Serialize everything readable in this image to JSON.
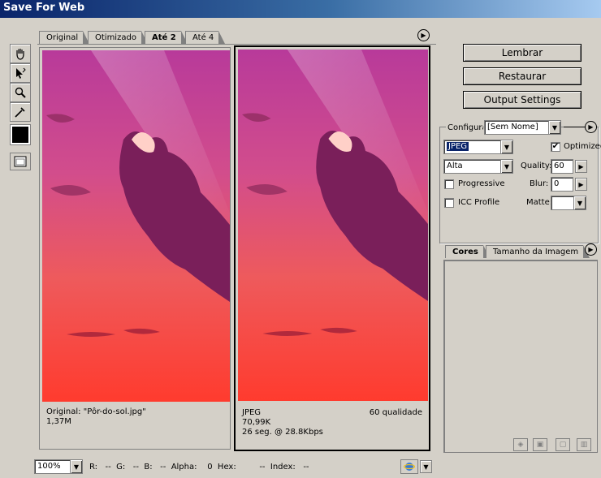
{
  "window": {
    "title": "Save For Web"
  },
  "tabs": [
    {
      "label": "Original"
    },
    {
      "label": "Otimizado"
    },
    {
      "label": "Até 2"
    },
    {
      "label": "Até 4"
    }
  ],
  "tools": [
    "hand-tool-icon",
    "slice-select-tool-icon",
    "zoom-tool-icon",
    "eyedropper-tool-icon"
  ],
  "panes": {
    "left": {
      "line1": "Original: \"Pôr-do-sol.jpg\"",
      "line2": "1,37M"
    },
    "right": {
      "format": "JPEG",
      "quality": "60 qualidade",
      "size": "70,99K",
      "speed": "26 seg. @ 28.8Kbps"
    }
  },
  "buttons": {
    "remember": "Lembrar",
    "restore": "Restaurar",
    "output": "Output Settings"
  },
  "settings": {
    "label": "Configurar",
    "preset": "[Sem Nome]",
    "format": "JPEG",
    "optimized_label": "Optimized",
    "optimized_checked": "✔",
    "quality_preset": "Alta",
    "quality_label": "Quality:",
    "quality_value": "60",
    "progressive_label": "Progressive",
    "blur_label": "Blur:",
    "blur_value": "0",
    "icc_label": "ICC Profile",
    "matte_label": "Matte:"
  },
  "color_tabs": {
    "colors": "Cores",
    "image_size": "Tamanho da Imagem"
  },
  "status": {
    "zoom": "100%",
    "readout": "R:   --  G:   --  B:   --  Alpha:    0  Hex:         --  Index:   --"
  },
  "colors": {
    "title_start": "#0a246a",
    "selection": "#0a246a"
  }
}
